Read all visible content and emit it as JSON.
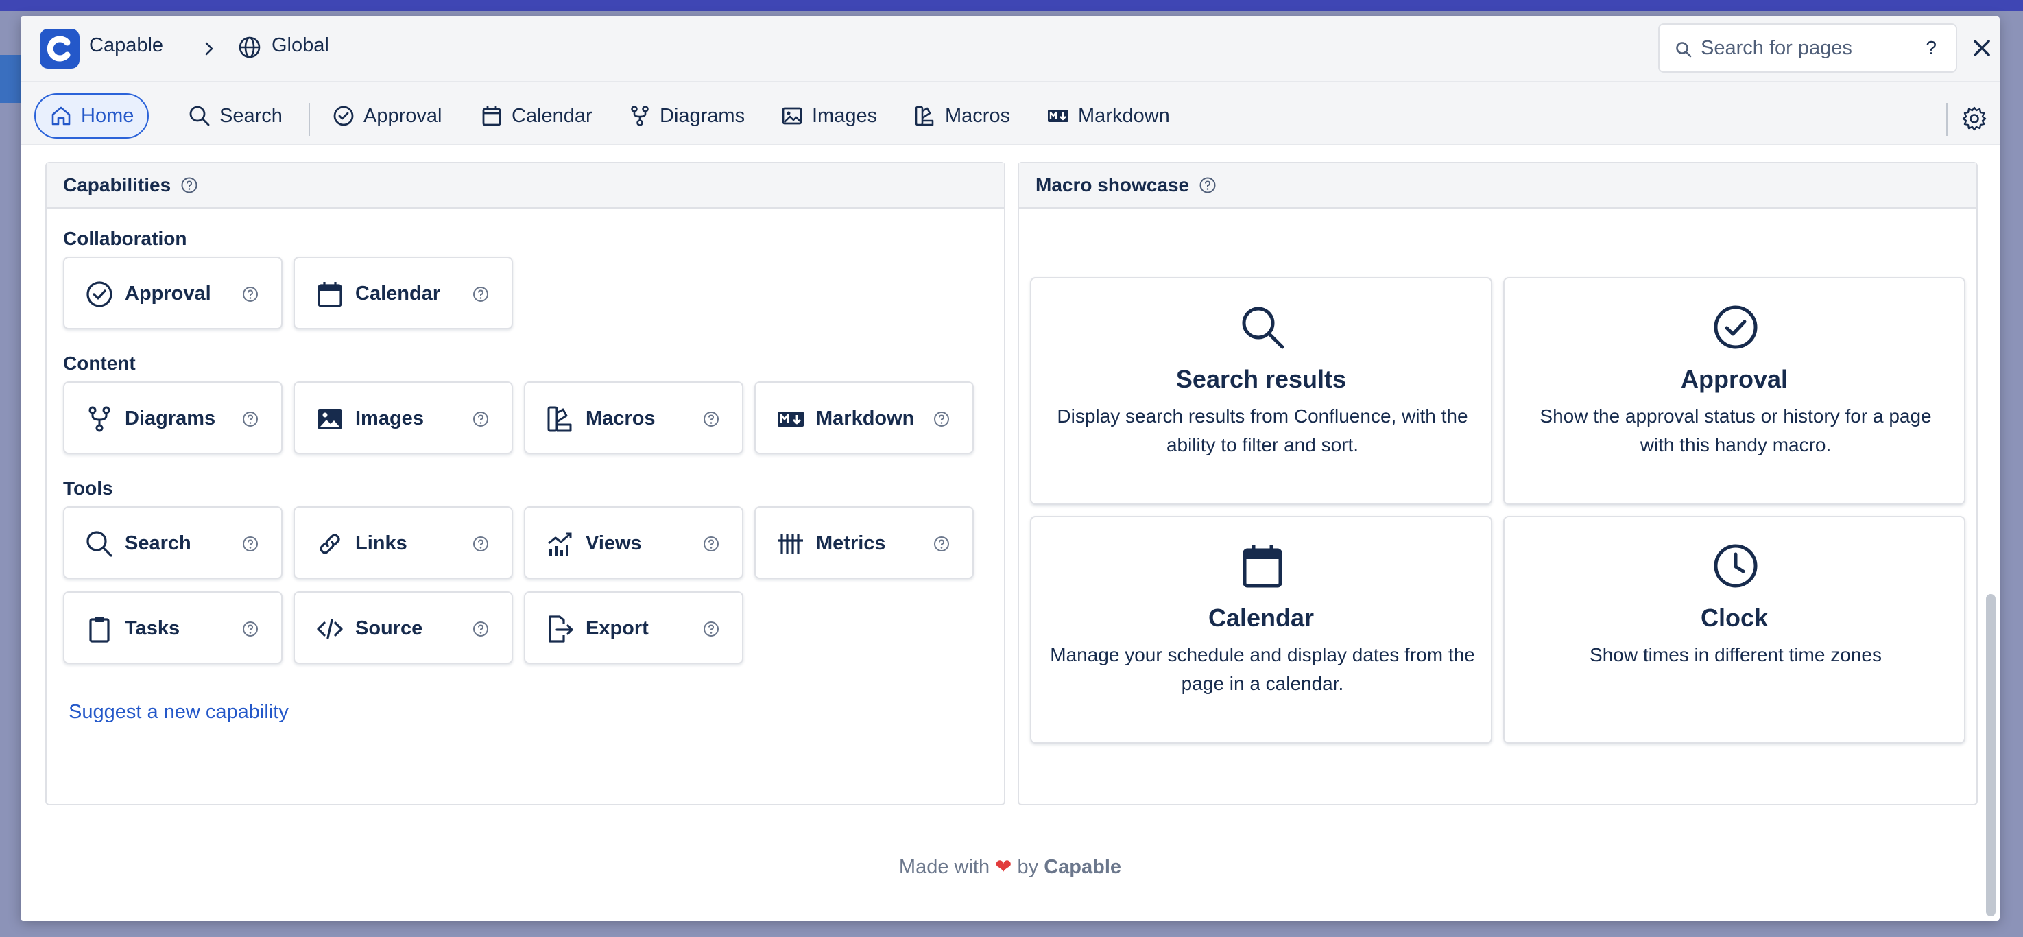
{
  "header": {
    "brand": "Capable",
    "breadcrumb": "Global",
    "search_placeholder": "Search for pages",
    "help": "?"
  },
  "nav": {
    "items": [
      "Home",
      "Search",
      "Approval",
      "Calendar",
      "Diagrams",
      "Images",
      "Macros",
      "Markdown"
    ]
  },
  "capabilities": {
    "title": "Capabilities",
    "sections": [
      {
        "title": "Collaboration",
        "items": [
          "Approval",
          "Calendar"
        ]
      },
      {
        "title": "Content",
        "items": [
          "Diagrams",
          "Images",
          "Macros",
          "Markdown"
        ]
      },
      {
        "title": "Tools",
        "items": [
          "Search",
          "Links",
          "Views",
          "Metrics",
          "Tasks",
          "Source",
          "Export"
        ]
      }
    ],
    "suggest_link": "Suggest a new capability"
  },
  "showcase": {
    "title": "Macro showcase",
    "cards": [
      {
        "title": "Search results",
        "desc": "Display search results from Confluence, with the ability to filter and sort.",
        "icon": "search-icon"
      },
      {
        "title": "Approval",
        "desc": "Show the approval status or history for a page with this handy macro.",
        "icon": "check-circle-icon"
      },
      {
        "title": "Calendar",
        "desc": "Manage your schedule and display dates from the page in a calendar.",
        "icon": "calendar-icon"
      },
      {
        "title": "Clock",
        "desc": "Show times in different time zones",
        "icon": "clock-icon"
      }
    ]
  },
  "footer": {
    "made_with": "Made with",
    "heart": "❤",
    "by": "by",
    "brand": "Capable"
  },
  "colors": {
    "accent": "#2458c9",
    "text": "#172b4d",
    "heart": "#e23b3b"
  }
}
